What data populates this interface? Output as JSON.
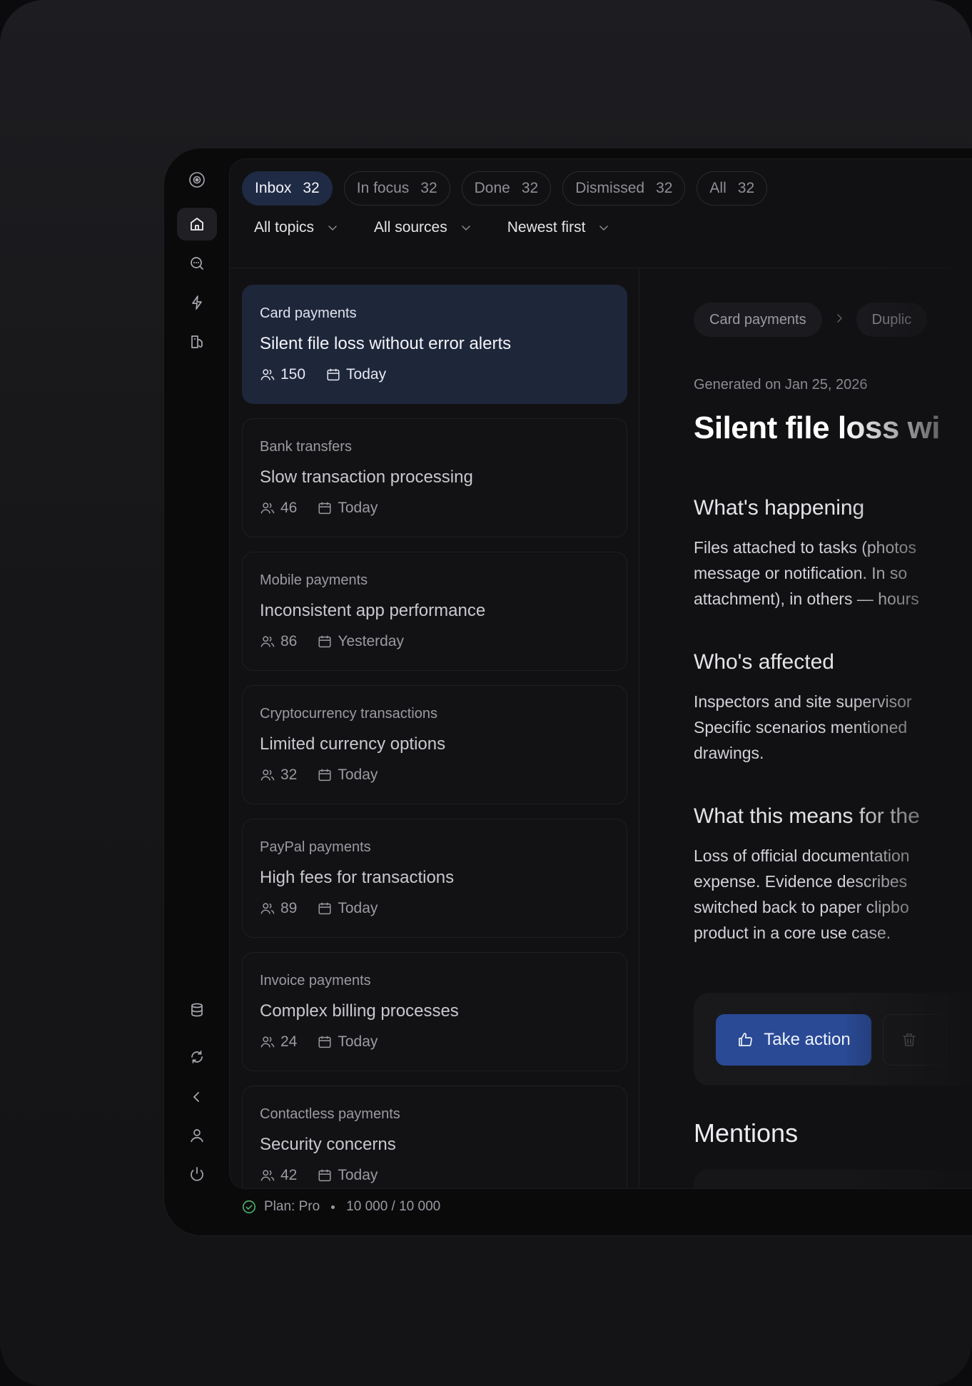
{
  "tabs": [
    {
      "label": "Inbox",
      "count": "32"
    },
    {
      "label": "In focus",
      "count": "32"
    },
    {
      "label": "Done",
      "count": "32"
    },
    {
      "label": "Dismissed",
      "count": "32"
    },
    {
      "label": "All",
      "count": "32"
    }
  ],
  "filters": {
    "topics": "All topics",
    "sources": "All sources",
    "sort": "Newest first"
  },
  "sidebar": {
    "top_icons": [
      "logo-icon",
      "home-icon",
      "search-icon",
      "lightning-icon",
      "sources-icon"
    ],
    "bottom_icons": [
      "database-icon",
      "sync-icon",
      "collapse-icon",
      "user-icon",
      "power-icon"
    ]
  },
  "items": [
    {
      "topic": "Card payments",
      "title": "Silent file loss without error alerts",
      "users": "150",
      "date": "Today"
    },
    {
      "topic": "Bank transfers",
      "title": "Slow transaction processing",
      "users": "46",
      "date": "Today"
    },
    {
      "topic": "Mobile payments",
      "title": "Inconsistent app performance",
      "users": "86",
      "date": "Yesterday"
    },
    {
      "topic": "Cryptocurrency transactions",
      "title": "Limited currency options",
      "users": "32",
      "date": "Today"
    },
    {
      "topic": "PayPal payments",
      "title": "High fees for transactions",
      "users": "89",
      "date": "Today"
    },
    {
      "topic": "Invoice payments",
      "title": "Complex billing processes",
      "users": "24",
      "date": "Today"
    },
    {
      "topic": "Contactless payments",
      "title": "Security concerns",
      "users": "42",
      "date": "Today"
    }
  ],
  "detail": {
    "breadcrumb": [
      "Card payments",
      "Duplic"
    ],
    "generated": "Generated on Jan 25, 2026",
    "title": "Silent file loss wi",
    "sections": [
      {
        "heading": "What's happening",
        "lines": [
          "Files attached to tasks (photos",
          "message or notification. In so",
          "attachment), in others — hours"
        ]
      },
      {
        "heading": "Who's affected",
        "lines": [
          "Inspectors and site supervisor",
          "Specific scenarios mentioned",
          "drawings."
        ]
      },
      {
        "heading": "What this means for the",
        "lines": [
          "Loss of official documentation",
          "expense. Evidence describes",
          "switched back to paper clipbo",
          "product in a core use case."
        ]
      }
    ],
    "primary_action": "Take action",
    "mentions_heading": "Mentions"
  },
  "status": {
    "plan": "Plan: Pro",
    "usage": "10 000 / 10 000"
  },
  "colors": {
    "accent": "#2a4a96",
    "active_card": "#1e263a",
    "active_tab": "#1f2a44",
    "status_ok": "#4caf6a"
  }
}
